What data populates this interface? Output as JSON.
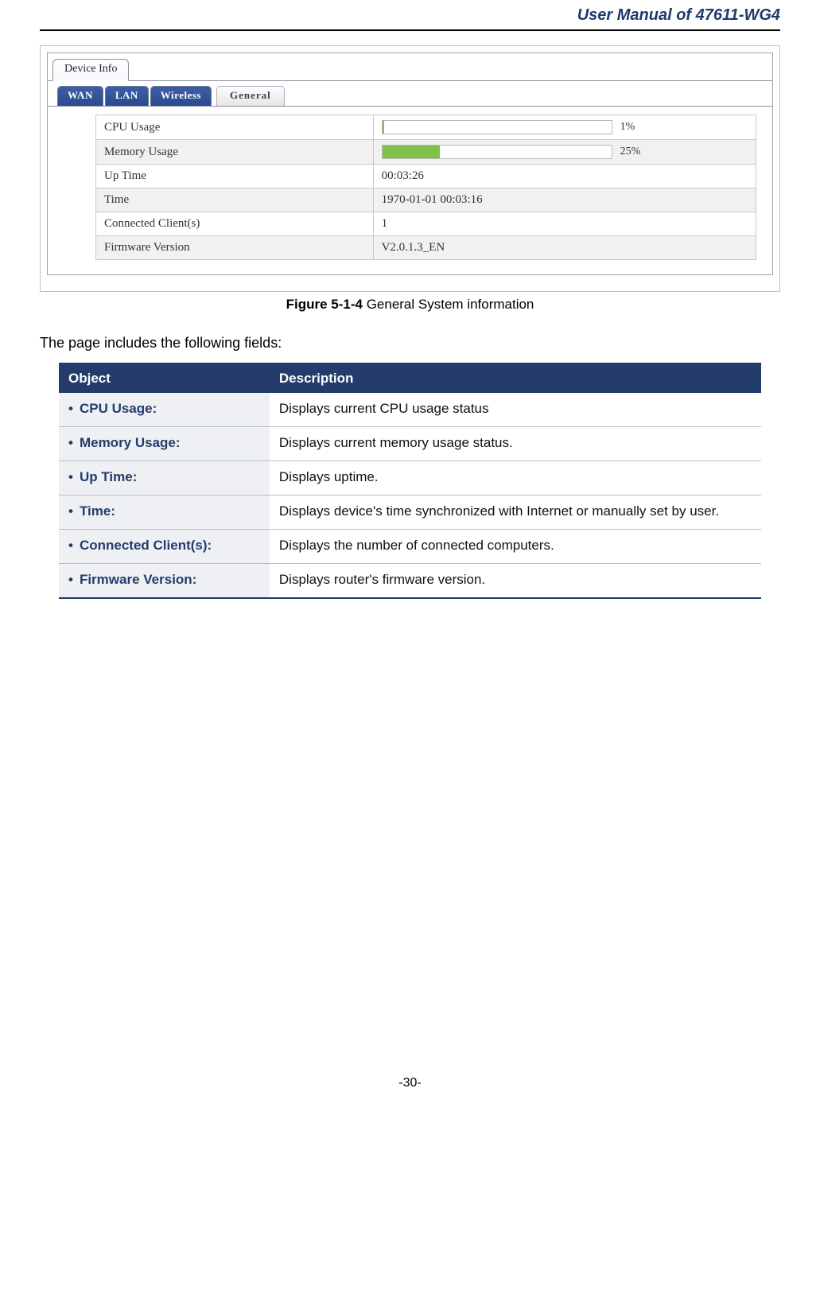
{
  "header": {
    "title": "User Manual of 47611-WG4"
  },
  "shot": {
    "topTab": "Device Info",
    "subTabs": [
      "WAN",
      "LAN",
      "Wireless",
      "General"
    ],
    "rows": [
      {
        "label": "CPU Usage",
        "type": "bar",
        "percent": 1,
        "pctText": "1%"
      },
      {
        "label": "Memory Usage",
        "type": "bar",
        "percent": 25,
        "pctText": "25%"
      },
      {
        "label": "Up Time",
        "type": "text",
        "value": "00:03:26"
      },
      {
        "label": "Time",
        "type": "text",
        "value": "1970-01-01 00:03:16"
      },
      {
        "label": "Connected Client(s)",
        "type": "text",
        "value": "1"
      },
      {
        "label": "Firmware Version",
        "type": "text",
        "value": "V2.0.1.3_EN"
      }
    ]
  },
  "figure": {
    "num": "Figure 5-1-4",
    "caption": "General System information"
  },
  "intro": "The page includes the following fields:",
  "descTable": {
    "headers": {
      "object": "Object",
      "description": "Description"
    },
    "rows": [
      {
        "obj": "CPU Usage:",
        "desc": "Displays current CPU usage status"
      },
      {
        "obj": "Memory Usage:",
        "desc": "Displays current memory usage status."
      },
      {
        "obj": "Up Time:",
        "desc": "Displays uptime."
      },
      {
        "obj": "Time:",
        "desc": "Displays device's time synchronized with Internet or manually set by user."
      },
      {
        "obj": "Connected Client(s):",
        "desc": "Displays the number of connected computers."
      },
      {
        "obj": "Firmware Version:",
        "desc": "Displays router's firmware version."
      }
    ]
  },
  "pageNum": "-30-",
  "chart_data": [
    {
      "type": "bar",
      "title": "CPU Usage",
      "categories": [
        "CPU Usage"
      ],
      "values": [
        1
      ],
      "ylim": [
        0,
        100
      ],
      "xlabel": "",
      "ylabel": "%"
    },
    {
      "type": "bar",
      "title": "Memory Usage",
      "categories": [
        "Memory Usage"
      ],
      "values": [
        25
      ],
      "ylim": [
        0,
        100
      ],
      "xlabel": "",
      "ylabel": "%"
    }
  ]
}
